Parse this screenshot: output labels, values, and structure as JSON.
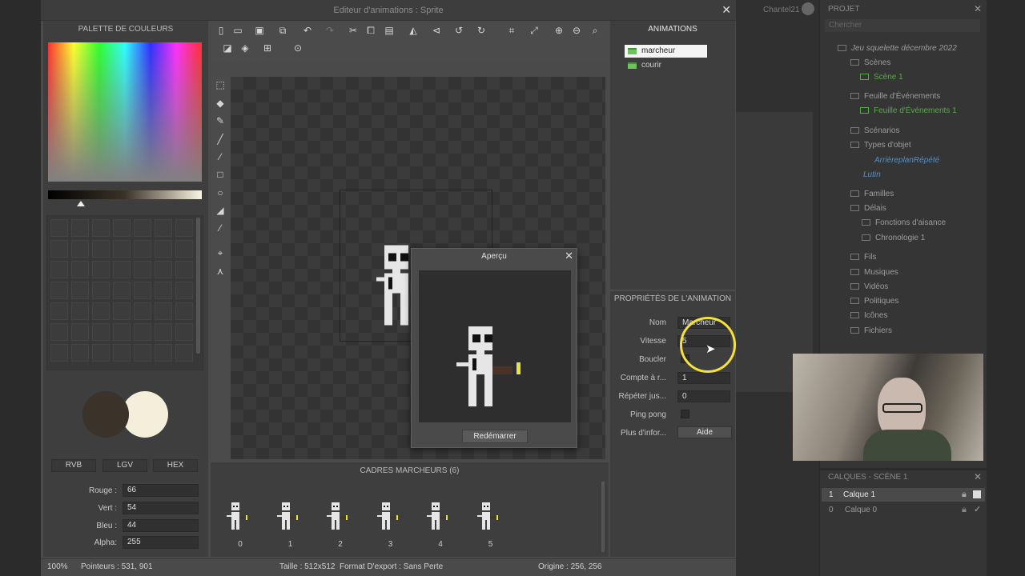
{
  "window": {
    "title": "Editeur d'animations : Sprite",
    "close_icon": "close-icon"
  },
  "palette": {
    "header": "PALETTE DE COULEURS",
    "primary_color": "#3b3329",
    "secondary_color": "#f4eeda",
    "modes": [
      "RVB",
      "LGV",
      "HEX"
    ],
    "channels": [
      {
        "label": "Rouge :",
        "value": "66"
      },
      {
        "label": "Vert :",
        "value": "54"
      },
      {
        "label": "Bleu :",
        "value": "44"
      },
      {
        "label": "Alpha:",
        "value": "255"
      }
    ]
  },
  "toolbar": {
    "icons_row1": [
      "new-file-icon",
      "open-folder-icon",
      "save-icon",
      "export-icon",
      "undo-icon",
      "redo-icon",
      "cut-icon",
      "copy-icon",
      "paste-icon",
      "flip-horizontal-icon",
      "flip-vertical-icon",
      "rotate-left-icon",
      "rotate-right-icon",
      "crop-icon",
      "resize-icon",
      "zoom-in-icon",
      "zoom-out-icon",
      "zoom-fit-icon"
    ],
    "icons_row2": [
      "onion-skin-icon",
      "layers-icon",
      "grid-icon",
      "play-icon"
    ]
  },
  "tools": [
    "select-icon",
    "eraser-icon",
    "pencil-icon",
    "brush-icon",
    "line-icon",
    "rectangle-icon",
    "ellipse-icon",
    "fill-icon",
    "eyedropper-icon",
    "origin-icon",
    "image-point-icon"
  ],
  "preview": {
    "title": "Aperçu",
    "restart_label": "Redémarrer"
  },
  "frames": {
    "header": "CADRES MARCHEURS (6)",
    "items": [
      "0",
      "1",
      "2",
      "3",
      "4",
      "5"
    ]
  },
  "animations": {
    "header": "ANIMATIONS",
    "items": [
      {
        "label": "marcheur",
        "selected": true
      },
      {
        "label": "courir",
        "selected": false
      }
    ]
  },
  "properties": {
    "header": "PROPRIÉTÉS DE L'ANIMATION",
    "rows": [
      {
        "label": "Nom",
        "value": "Marcheur"
      },
      {
        "label": "Vitesse",
        "value": "5"
      },
      {
        "label": "Boucler",
        "value": ""
      },
      {
        "label": "Compte à r...",
        "value": "1"
      },
      {
        "label": "Répéter jus...",
        "value": "0"
      },
      {
        "label": "Ping pong",
        "value": ""
      },
      {
        "label": "Plus d'infor...",
        "value": "Aide"
      }
    ]
  },
  "status": {
    "zoom": "100%",
    "pointers": "Pointeurs : 531, 901",
    "size": "Taille : 512x512",
    "export": "Format D'export : Sans Perte",
    "origin": "Origine : 256, 256"
  },
  "topbar": {
    "user": "Chantel21"
  },
  "project": {
    "header": "PROJET",
    "search_placeholder": "Chercher",
    "tree": [
      {
        "label": "Jeu squelette décembre 2022",
        "style": "italic"
      },
      {
        "label": "Scènes"
      },
      {
        "label": "Scène 1",
        "style": "green"
      },
      {
        "label": "Feuille d'Événements"
      },
      {
        "label": "Feuille d'Événements 1",
        "style": "green"
      },
      {
        "label": "Scénarios"
      },
      {
        "label": "Types d'objet"
      },
      {
        "label": "ArrièreplanRépété",
        "style": "blue"
      },
      {
        "label": "Lutin",
        "style": "blue"
      },
      {
        "label": "Familles"
      },
      {
        "label": "Délais"
      },
      {
        "label": "Fonctions d'aisance"
      },
      {
        "label": "Chronologie 1"
      },
      {
        "label": "Fils"
      },
      {
        "label": "Musiques"
      },
      {
        "label": "Vidéos"
      },
      {
        "label": "Politiques"
      },
      {
        "label": "Icônes"
      },
      {
        "label": "Fichiers"
      }
    ]
  },
  "layers": {
    "header": "CALQUES - SCÈNE 1",
    "items": [
      {
        "index": "1",
        "label": "Calque 1"
      },
      {
        "index": "0",
        "label": "Calque 0"
      }
    ]
  }
}
